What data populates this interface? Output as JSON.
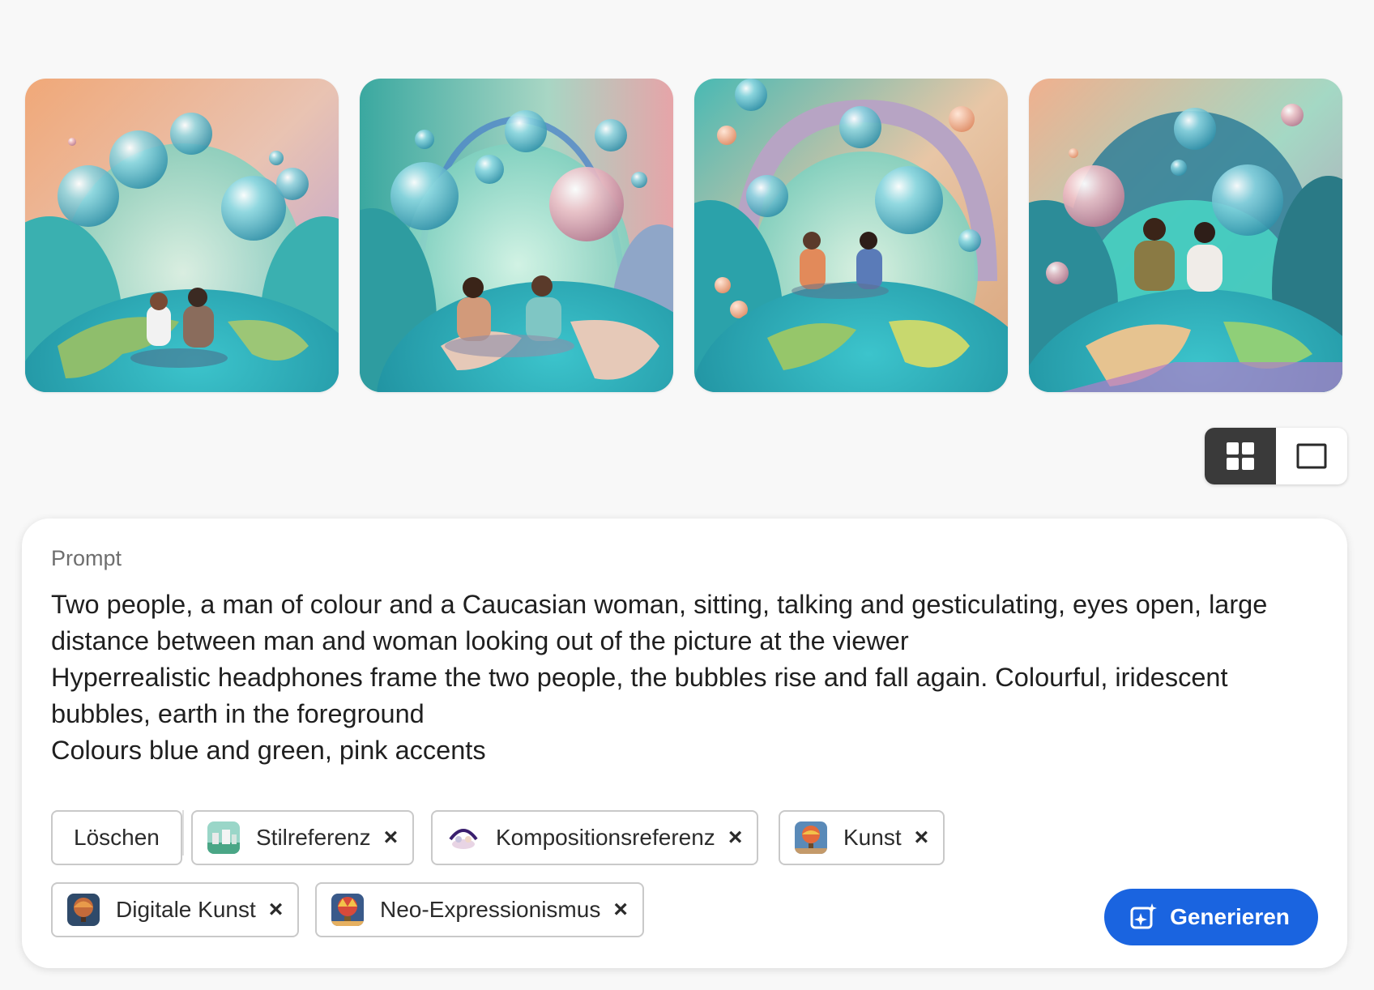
{
  "gallery": {
    "images": [
      {
        "name": "generated-image-1"
      },
      {
        "name": "generated-image-2"
      },
      {
        "name": "generated-image-3"
      },
      {
        "name": "generated-image-4"
      }
    ]
  },
  "view_toggle": {
    "grid_icon": "grid-view-icon",
    "single_icon": "single-view-icon",
    "active": "grid"
  },
  "prompt": {
    "label": "Prompt",
    "text": "Two people, a man of colour and a Caucasian woman, sitting, talking and gesticulating, eyes open, large distance between man and woman looking out of the picture at the viewer\nHyperrealistic headphones frame the two people, the bubbles rise and fall again. Colourful, iridescent bubbles, earth in the foreground\nColours blue and green, pink accents"
  },
  "chips": {
    "delete_label": "Löschen",
    "style_ref": "Stilreferenz",
    "composition_ref": "Kompositionsreferenz",
    "art": "Kunst",
    "digital_art": "Digitale Kunst",
    "neo_expressionism": "Neo-Expressionismus",
    "remove_glyph": "×"
  },
  "generate": {
    "label": "Generieren",
    "icon": "sparkle-generate-icon",
    "color": "#1a64e0"
  }
}
